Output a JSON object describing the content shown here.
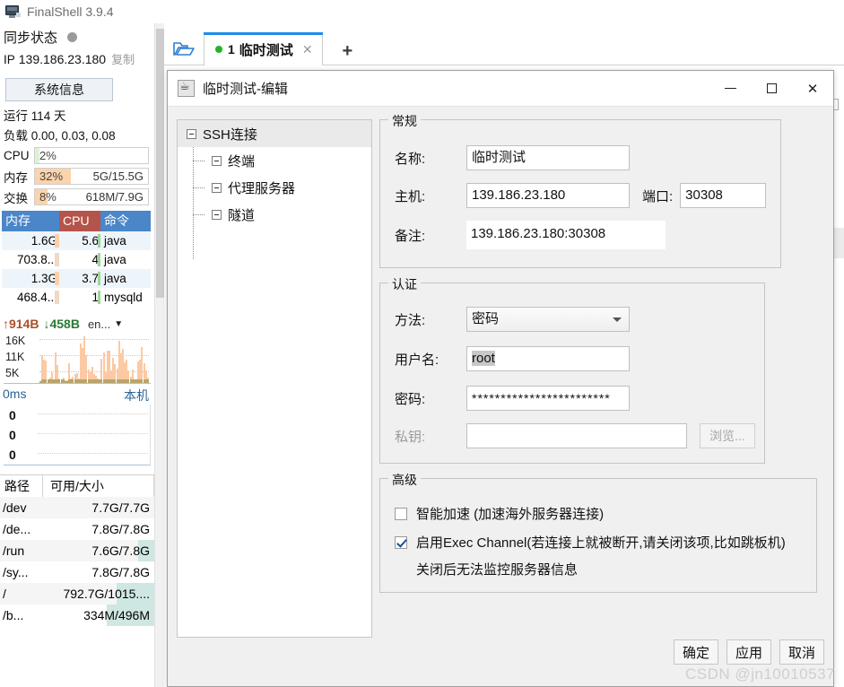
{
  "app": {
    "title": "FinalShell 3.9.4",
    "logo_icon": "monitor-icon"
  },
  "sidebar": {
    "sync_label": "同步状态",
    "sync_dot_color": "#9a9a9a",
    "ip_prefix": "IP",
    "ip_value": "139.186.23.180",
    "ip_copy": "复制",
    "sysinfo_button": "系统信息",
    "uptime": "运行 114 天",
    "load": "负载 0.00, 0.03, 0.08",
    "meters": [
      {
        "name": "CPU",
        "pct": "2%",
        "fill": 4,
        "abs": "",
        "color": "#dff0d8"
      },
      {
        "name": "内存",
        "pct": "32%",
        "fill": 32,
        "abs": "5G/15.5G",
        "color": "#fbd3ad"
      },
      {
        "name": "交换",
        "pct": "8%",
        "fill": 8,
        "abs": "618M/7.9G",
        "color": "#fbd3ad"
      }
    ],
    "processes": {
      "headers": [
        "内存",
        "CPU",
        "命令"
      ],
      "header_colors": {
        "mem": "#4a86c8",
        "cpu": "#b5544a",
        "cmd": "#4a86c8"
      },
      "rows": [
        {
          "mem": "1.6G",
          "mem_bar": 9,
          "cpu": "5.6",
          "cpu_bar": 6,
          "cmd": "java"
        },
        {
          "mem": "703.8...",
          "mem_bar": 3,
          "cpu": "4",
          "cpu_bar": 5,
          "cmd": "java"
        },
        {
          "mem": "1.3G",
          "mem_bar": 8,
          "cpu": "3.7",
          "cpu_bar": 5,
          "cmd": "java"
        },
        {
          "mem": "468.4...",
          "mem_bar": 3,
          "cpu": "1",
          "cpu_bar": 4,
          "cmd": "mysqld"
        }
      ]
    },
    "network": {
      "upload": "↑914B",
      "download": "↓458B",
      "interface": "en...",
      "caret_icon": "chevron-down-icon",
      "y_labels": [
        "16K",
        "11K",
        "5K"
      ]
    },
    "ping": {
      "latency": "0ms",
      "target": "本机",
      "y_labels": [
        "0",
        "0",
        "0"
      ]
    },
    "disks": {
      "headers": [
        "路径",
        "可用/大小"
      ],
      "rows": [
        {
          "path": "/dev",
          "size": "7.7G/7.7G",
          "bar": 0
        },
        {
          "path": "/de...",
          "size": "7.8G/7.8G",
          "bar": 0
        },
        {
          "path": "/run",
          "size": "7.6G/7.8G",
          "bar": 18
        },
        {
          "path": "/sy...",
          "size": "7.8G/7.8G",
          "bar": 0
        },
        {
          "path": "/",
          "size": "792.7G/1015....",
          "bar": 42
        },
        {
          "path": "/b...",
          "size": "334M/496M",
          "bar": 50
        }
      ]
    }
  },
  "tabbar": {
    "folder_icon": "open-folder-icon",
    "tabs": [
      {
        "num": "1",
        "label": "临时测试",
        "status_dot": "#22b422",
        "close_icon": "close-icon",
        "active": true
      }
    ],
    "add_tab_icon": "plus-icon"
  },
  "dialog": {
    "icon": "java-coffee-icon",
    "title": "临时测试-编辑",
    "window_buttons": {
      "minimize": "minimize-icon",
      "maximize": "maximize-icon",
      "close": "close-icon"
    },
    "tree": {
      "root": "SSH连接",
      "children": [
        "终端",
        "代理服务器",
        "隧道"
      ]
    },
    "general": {
      "title": "常规",
      "name_label": "名称:",
      "name_value": "临时测试",
      "host_label": "主机:",
      "host_value": "139.186.23.180",
      "port_label": "端口:",
      "port_value": "30308",
      "note_label": "备注:",
      "note_value": "139.186.23.180:30308"
    },
    "auth": {
      "title": "认证",
      "method_label": "方法:",
      "method_value": "密码",
      "username_label": "用户名:",
      "username_value": "root",
      "password_label": "密码:",
      "password_value": "************************",
      "privkey_label": "私钥:",
      "privkey_value": "",
      "browse_label": "浏览..."
    },
    "advanced": {
      "title": "高级",
      "accel_label": "智能加速 (加速海外服务器连接)",
      "accel_checked": false,
      "exec_label": "启用Exec Channel(若连接上就被断开,请关闭该项,比如跳板机)",
      "exec_checked": true,
      "exec_note": "关闭后无法监控服务器信息"
    },
    "actions": {
      "ok": "确定",
      "apply": "应用",
      "cancel": "取消"
    }
  },
  "watermark": "CSDN @jn10010537",
  "background": {
    "right_fragments": [
      "9",
      "9",
      "9"
    ]
  }
}
